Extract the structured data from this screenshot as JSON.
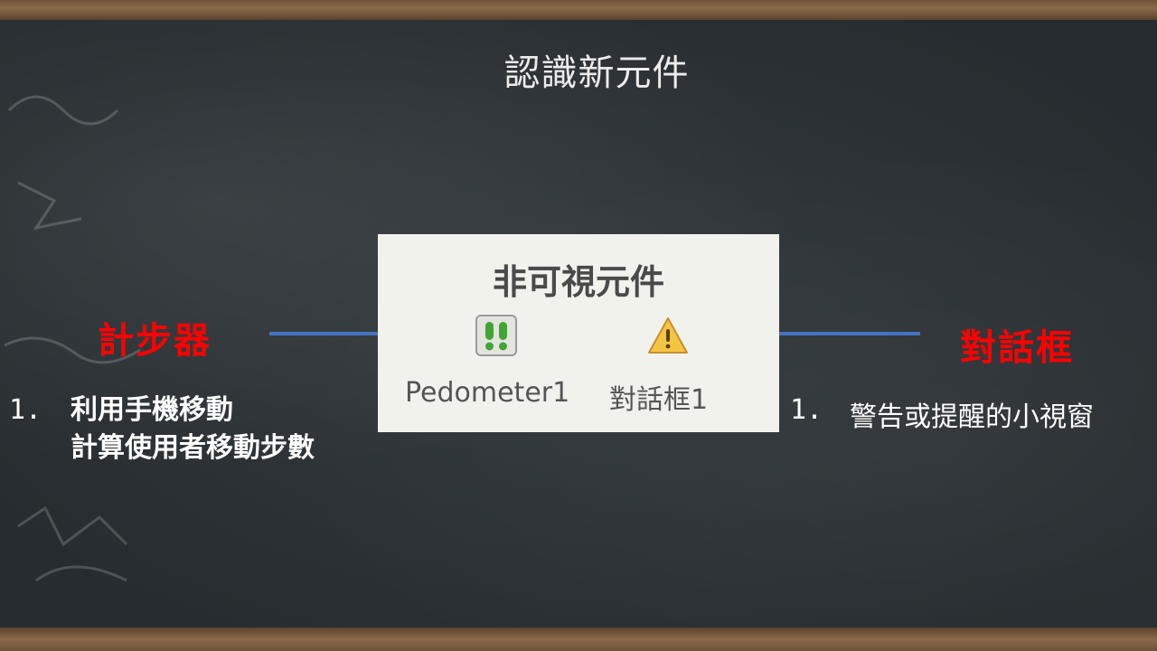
{
  "slide": {
    "title": "認識新元件"
  },
  "panel": {
    "title": "非可視元件",
    "components": [
      {
        "label": "Pedometer1",
        "icon": "pedometer-footprints-icon"
      },
      {
        "label": "對話框1",
        "icon": "warning-triangle-icon"
      }
    ]
  },
  "left": {
    "title": "計步器",
    "number": "1.",
    "lines": [
      "利用手機移動",
      "計算使用者移動步數"
    ]
  },
  "right": {
    "title": "對話框",
    "number": "1.",
    "text": "警告或提醒的小視窗"
  },
  "colors": {
    "accent_red": "#ff0000",
    "connector_blue": "#4472c4",
    "pedometer_green": "#3fa535",
    "warning_yellow": "#f4c542"
  }
}
